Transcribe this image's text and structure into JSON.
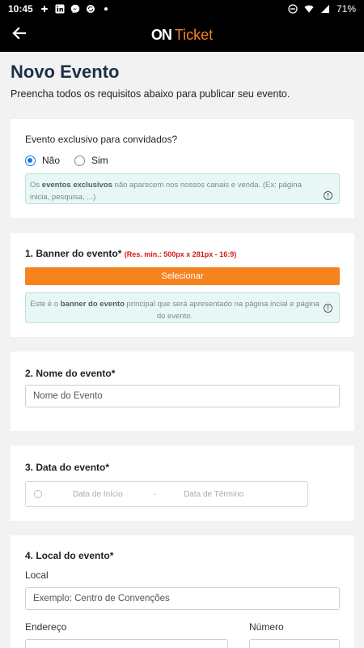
{
  "status_bar": {
    "time": "10:45",
    "battery": "71%"
  },
  "app_bar": {
    "logo_on": "ON",
    "logo_ticket": "Ticket"
  },
  "page": {
    "title": "Novo Evento",
    "subtitle": "Preencha todos os requisitos abaixo para publicar seu evento."
  },
  "exclusive": {
    "question": "Evento exclusivo para convidados?",
    "option_no": "Não",
    "option_yes": "Sim",
    "selected": "Não",
    "info_prefix": "Os ",
    "info_bold": "eventos exclusivos",
    "info_suffix": " não aparecem nos nossos canais e venda. (Ex: página inicia, pesquisa, ...)"
  },
  "banner": {
    "title": "1. Banner do evento",
    "asterisk": "*",
    "requirement": "(Res. min.: 500px x 281px - 16:9)",
    "button": "Selecionar",
    "info_prefix": "Este é o ",
    "info_bold": "banner do evento",
    "info_suffix": " principal que será apresentado na página incial e página do evento."
  },
  "name": {
    "title": "2. Nome do evento*",
    "placeholder": "Nome do Evento"
  },
  "date": {
    "title": "3. Data do evento*",
    "start_placeholder": "Data de Início",
    "separator": "-",
    "end_placeholder": "Data de Término"
  },
  "location": {
    "title": "4. Local do evento*",
    "local_label": "Local",
    "local_placeholder": "Exemplo: Centro de Convenções",
    "address_label": "Endereço",
    "number_label": "Número"
  }
}
